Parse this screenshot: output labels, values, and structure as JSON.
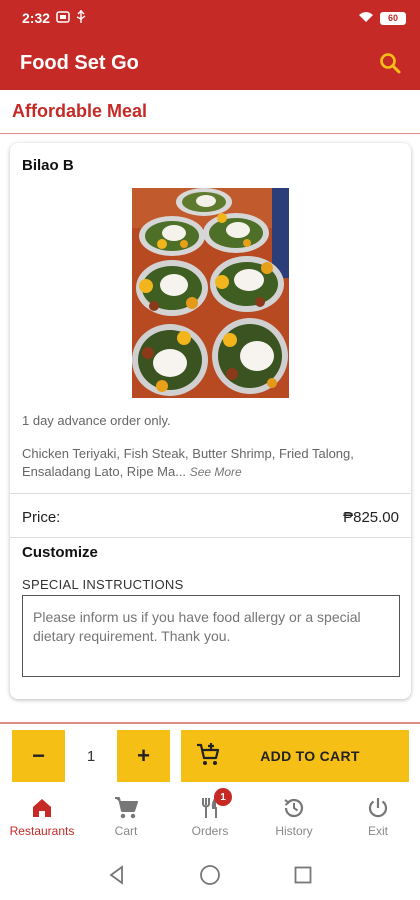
{
  "status_bar": {
    "time": "2:32",
    "battery": "60"
  },
  "app_bar": {
    "title": "Food Set Go",
    "search_icon": "search-icon"
  },
  "section": {
    "title": "Affordable Meal"
  },
  "item": {
    "name": "Bilao B",
    "note": "1 day advance order only.",
    "description": "Chicken Teriyaki, Fish Steak, Butter Shrimp, Fried Talong, Ensaladang Lato, Ripe Ma...",
    "see_more": "See More",
    "price_label": "Price:",
    "price_value": "₱825.00",
    "customize_label": "Customize",
    "instructions_label": "SPECIAL INSTRUCTIONS",
    "instructions_placeholder": "Please inform us if you have food allergy or a special dietary requirement. Thank you."
  },
  "order": {
    "minus": "−",
    "quantity": "1",
    "plus": "+",
    "add_to_cart": "ADD TO CART"
  },
  "bottom_nav": {
    "items": [
      {
        "label": "Restaurants",
        "icon": "store-icon",
        "active": true
      },
      {
        "label": "Cart",
        "icon": "cart-icon"
      },
      {
        "label": "Orders",
        "icon": "fork-knife-icon",
        "badge": "1"
      },
      {
        "label": "History",
        "icon": "history-icon"
      },
      {
        "label": "Exit",
        "icon": "power-icon"
      }
    ]
  },
  "colors": {
    "primary": "#c62a26",
    "accent": "#f6bf16"
  }
}
